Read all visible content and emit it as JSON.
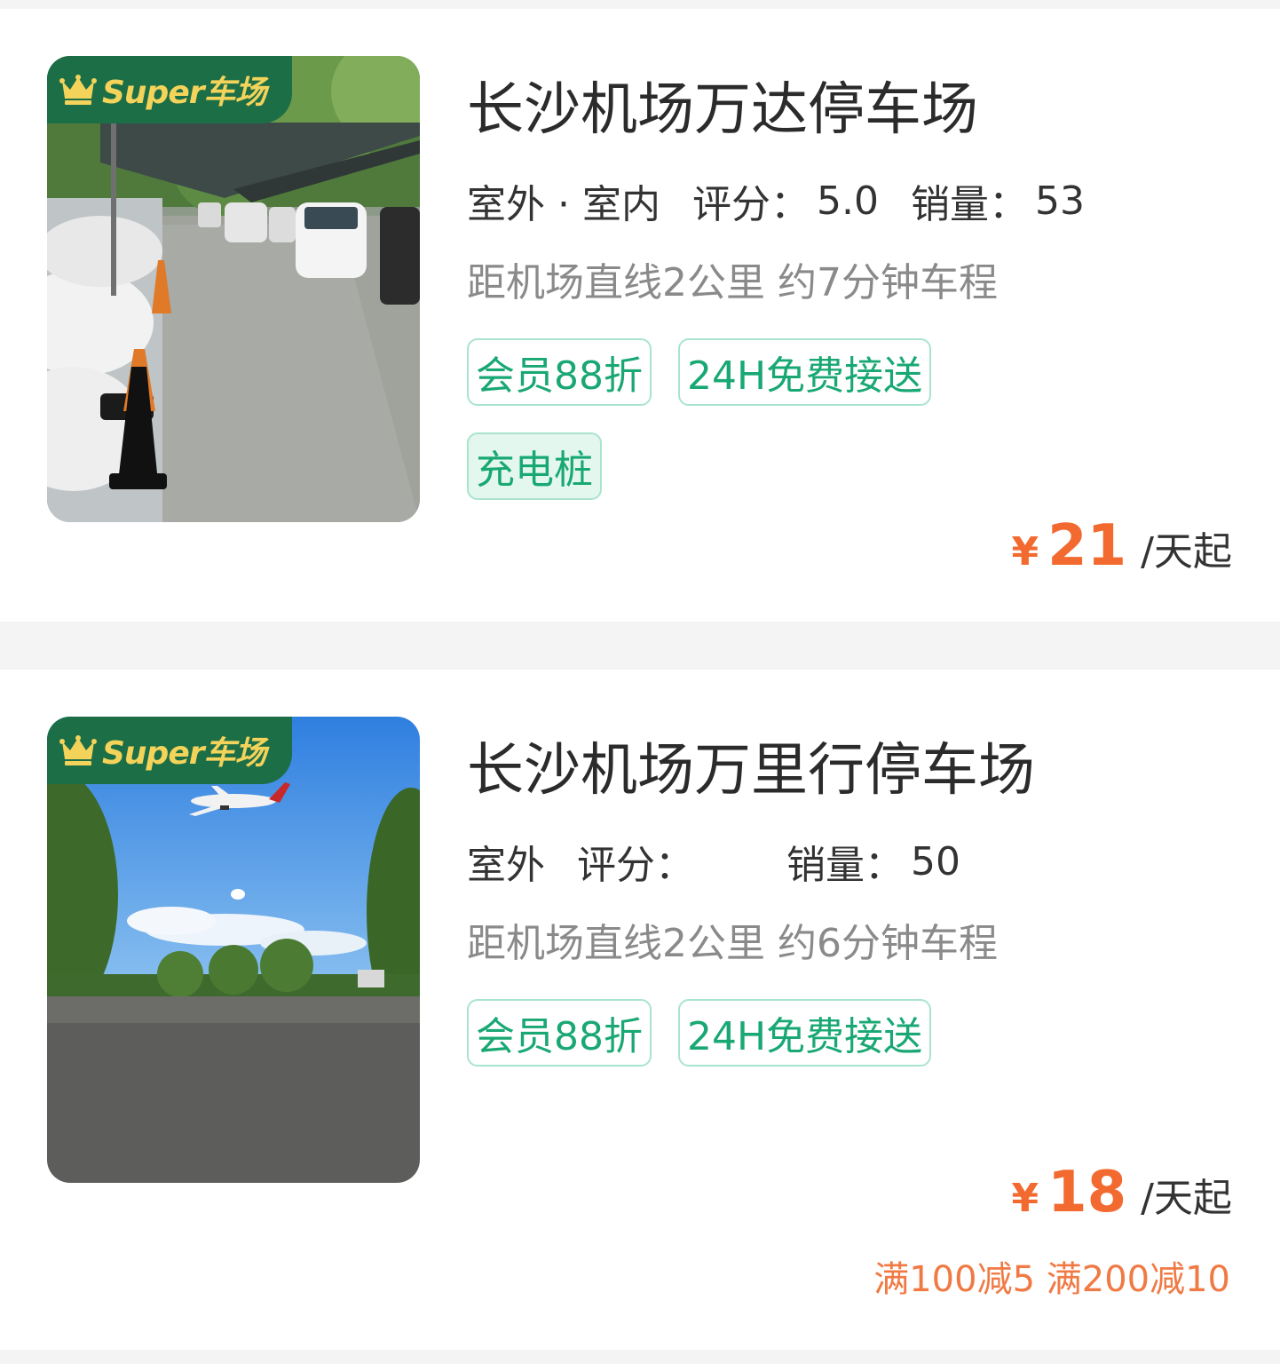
{
  "lots": [
    {
      "badge": "Super车场",
      "name": "长沙机场万达停车场",
      "type": "室外 · 室内",
      "rating_label": "评分：",
      "rating": "5.0",
      "sales_label": "销量：",
      "sales": "53",
      "distance": "距机场直线2公里 约7分钟车程",
      "tags": [
        "会员88折",
        "24H免费接送",
        "充电桩"
      ],
      "currency": "¥",
      "price": "21",
      "price_unit": "/天起",
      "promo": ""
    },
    {
      "badge": "Super车场",
      "name": "长沙机场万里行停车场",
      "type": "室外",
      "rating_label": "评分：",
      "rating": "",
      "sales_label": "销量：",
      "sales": "50",
      "distance": "距机场直线2公里 约6分钟车程",
      "tags": [
        "会员88折",
        "24H免费接送"
      ],
      "currency": "¥",
      "price": "18",
      "price_unit": "/天起",
      "promo": "满100减5 满200减10"
    }
  ],
  "colors": {
    "accent_green": "#19a874",
    "badge_green": "#1c6e47",
    "badge_gold": "#f3d35a",
    "price_orange": "#f26a2f"
  },
  "icons": {
    "badge": "crown-icon"
  }
}
